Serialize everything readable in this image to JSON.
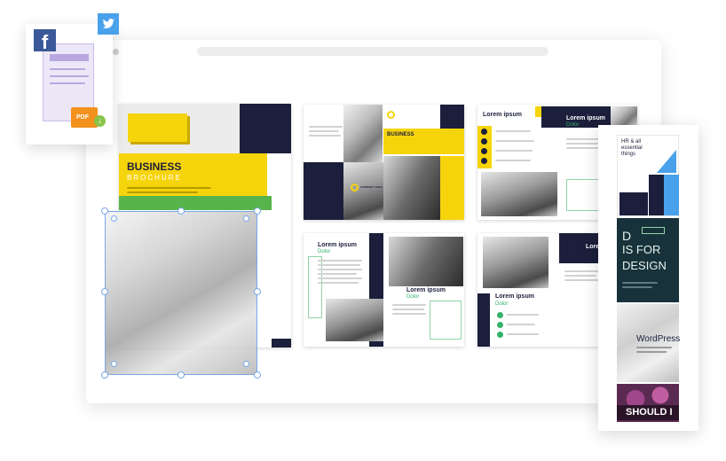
{
  "brochure": {
    "title": "BUSINESS",
    "subtitle": "BROCHURE",
    "inner_title": "BUSINESS",
    "company_logo": "COMPANY LOGO"
  },
  "spreads": {
    "lorem": "Lorem ipsum",
    "dolor": "Dolor",
    "lorem_short": "Lore"
  },
  "strip": {
    "hr_title": "HR & all essential things",
    "design_line1": "D",
    "design_line2": "IS FOR",
    "design_line3": "DESIGN",
    "wordpress": "WordPress",
    "should": "SHOULD I"
  },
  "file_card": {
    "pdf_label": "PDF"
  },
  "icons": [
    "facebook-icon",
    "twitter-icon",
    "pdf-file-icon",
    "download-icon"
  ],
  "colors": {
    "accent_yellow": "#f6d40c",
    "navy": "#1b1f3b",
    "green": "#34b26a",
    "selection_blue": "#7aa8e6"
  }
}
